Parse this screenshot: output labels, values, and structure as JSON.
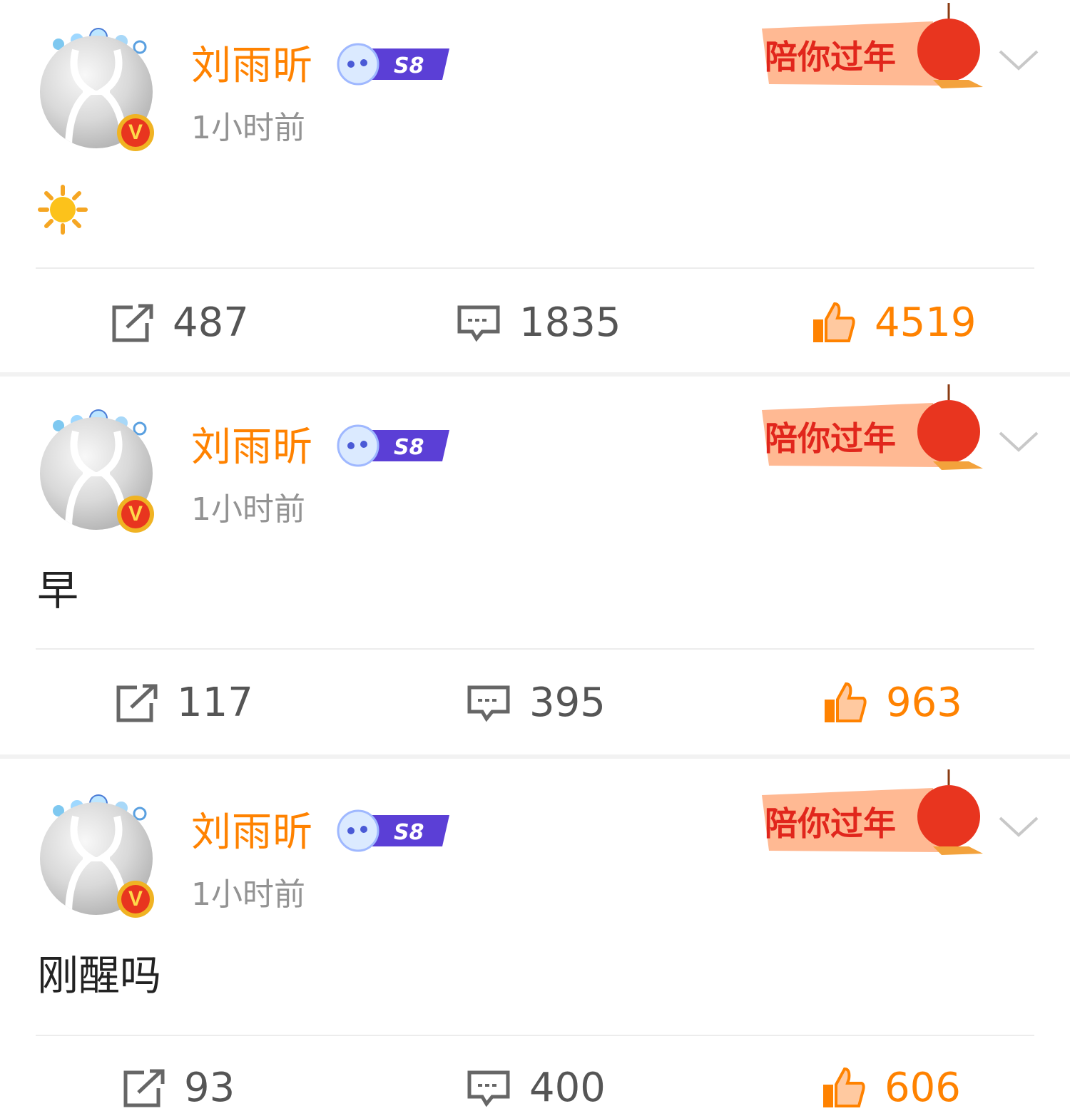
{
  "posts": [
    {
      "username": "刘雨昕",
      "level": "S8",
      "time": "1小时前",
      "festival_badge": "陪你过年",
      "content_emoji": "☀",
      "content": "",
      "reposts": "487",
      "comments": "1835",
      "likes": "4519"
    },
    {
      "username": "刘雨昕",
      "level": "S8",
      "time": "1小时前",
      "festival_badge": "陪你过年",
      "content": "早",
      "reposts": "117",
      "comments": "395",
      "likes": "963"
    },
    {
      "username": "刘雨昕",
      "level": "S8",
      "time": "1小时前",
      "festival_badge": "陪你过年",
      "content": "刚醒吗",
      "reposts": "93",
      "comments": "400",
      "likes": "606"
    }
  ],
  "colors": {
    "username": "#ff8200",
    "like": "#ff8200",
    "timestamp": "#939393",
    "badge_purple": "#5b3fd6",
    "festival_red": "#e8351f"
  },
  "icons": {
    "repost": "repost-icon",
    "comment": "comment-icon",
    "like": "thumbs-up-icon",
    "more": "chevron-down-icon",
    "verified": "verified-v-icon"
  }
}
